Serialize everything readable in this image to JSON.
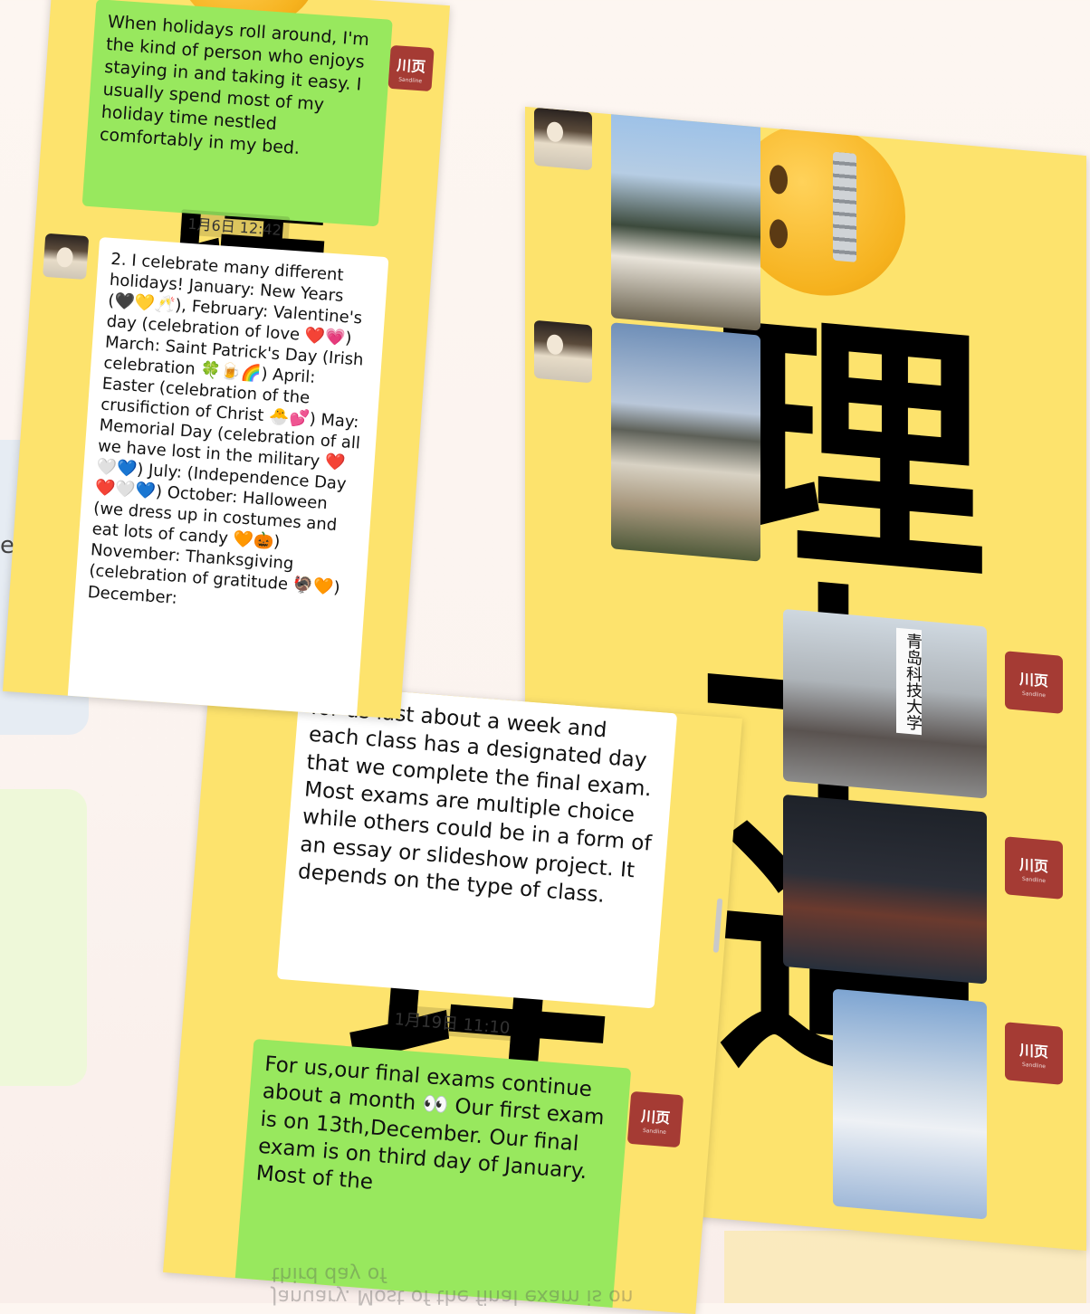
{
  "background": {
    "partial_letter": "e"
  },
  "shot1": {
    "bubble_top": "When holidays roll around, I'm the kind of person who enjoys staying in and taking it easy. I usually spend most of my holiday time nestled comfortably in my bed.",
    "timestamp": "1月6日 12:42",
    "bubble_reply": "2. I celebrate many different holidays! January:  New Years (🖤💛🥂), February: Valentine's day (celebration of love ❤️💗) March: Saint Patrick's Day (Irish celebration 🍀🍺🌈) April: Easter (celebration of the crusifiction of Christ 🐣💕) May: Memorial Day (celebration of all we have lost in the military ❤️🤍💙) July: (Independence Day ❤️🤍💙) October: Halloween (we dress up in costumes and eat lots of candy 🧡🎃) November: Thanksgiving (celebration of gratitude 🦃🧡) December:",
    "avatar_me_label": "川页",
    "avatar_me_sub": "Sandline"
  },
  "shot2": {
    "avatar_me_label": "川页",
    "avatar_me_sub": "Sandline",
    "sign_text": "青岛科技大学"
  },
  "shot3": {
    "bubble_white": "for us last about a week and each class has a designated day that we complete the final exam. Most exams are multiple choice while others could be in a form of an essay or slideshow project. It depends on the type of class.",
    "timestamp": "1月19日 11:10",
    "bubble_green": "For us,our final exams continue about a month 👀 Our first exam is on 13th,December. Our final exam is on third day of January. Most of the",
    "reflection_text": "January. Most of the final exam is on third day of",
    "avatar_me_label": "川页",
    "avatar_me_sub": "Sandline"
  },
  "colors": {
    "chat_bg": "#fde36d",
    "bubble_green": "#98e85e",
    "avatar_me": "#a53b34"
  },
  "icons": [
    "avatar-user",
    "avatar-me",
    "zipper-mouth-emoji"
  ]
}
